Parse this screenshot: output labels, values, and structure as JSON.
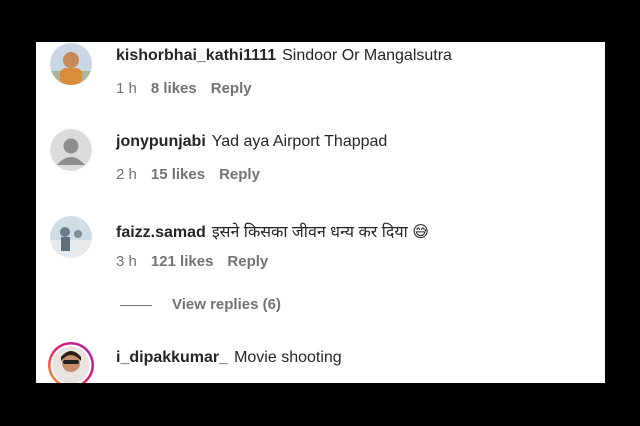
{
  "comments": [
    {
      "username": "kishorbhai_kathi1111",
      "text": "Sindoor Or Mangalsutra",
      "time": "1 h",
      "likes": "8 likes",
      "reply": "Reply",
      "avatar": "user-photo-avatar"
    },
    {
      "username": "jonypunjabi",
      "text": "Yad aya Airport Thappad",
      "time": "2 h",
      "likes": "15 likes",
      "reply": "Reply",
      "avatar": "default-user-avatar"
    },
    {
      "username": "faizz.samad",
      "text": "इसने किसका जीवन धन्य कर दिया 😅",
      "time": "3 h",
      "likes": "121 likes",
      "reply": "Reply",
      "avatar": "user-photo-avatar"
    },
    {
      "username": "i_dipakkumar_",
      "text": "Movie shooting",
      "avatar": "story-ring-avatar"
    }
  ],
  "view_replies": "View replies (6)",
  "colors": {
    "username": "#262626",
    "meta": "#737373",
    "background": "#ffffff",
    "frame": "#000000"
  }
}
